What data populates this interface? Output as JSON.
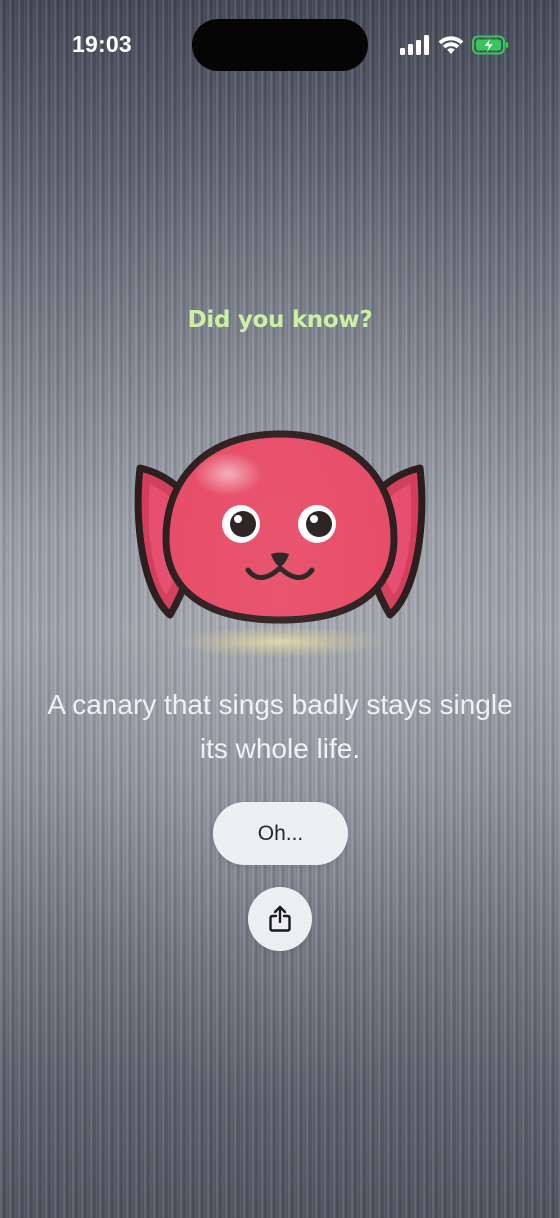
{
  "status_bar": {
    "time": "19:03",
    "icons": [
      "cellular-signal-icon",
      "wifi-icon",
      "battery-charging-icon"
    ],
    "battery_color": "#34c759"
  },
  "fact_card": {
    "headline": "Did you know?",
    "mascot": "pink-cat-mascot",
    "fact": "A canary that sings badly stays single its whole life.",
    "dismiss_label": "Oh...",
    "share_icon": "share-icon"
  },
  "colors": {
    "headline": "#c9f0a0",
    "mascot_body": "#e6435f",
    "button_bg": "#eceef1"
  }
}
